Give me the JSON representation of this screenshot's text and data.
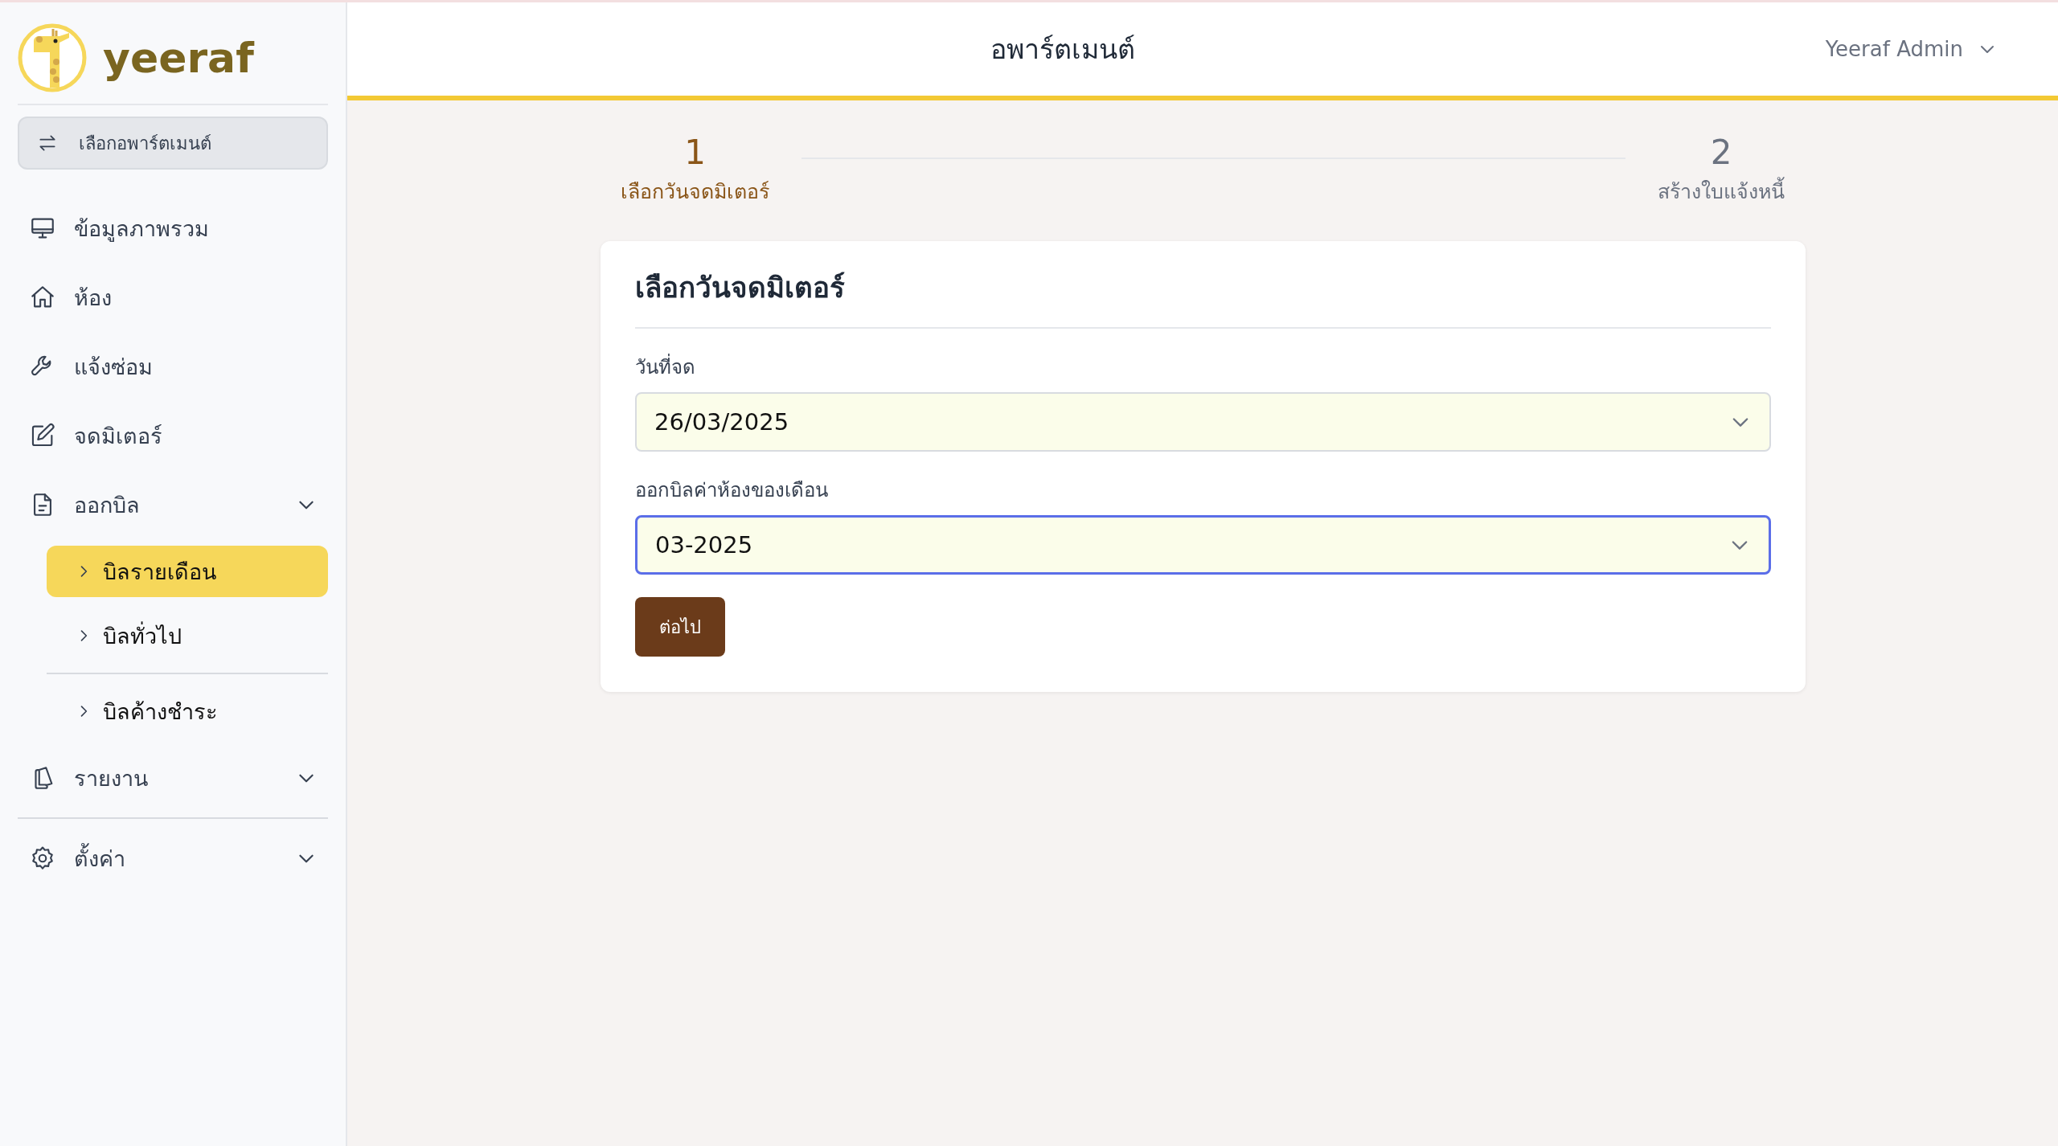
{
  "brand": {
    "name": "yeeraf"
  },
  "apartment_switch": {
    "label": "เลือกอพาร์ตเมนต์"
  },
  "sidebar": {
    "items": [
      {
        "label": "ข้อมูลภาพรวม",
        "kind": "link"
      },
      {
        "label": "ห้อง",
        "kind": "link"
      },
      {
        "label": "แจ้งซ่อม",
        "kind": "link"
      },
      {
        "label": "จดมิเตอร์",
        "kind": "link"
      },
      {
        "label": "ออกบิล",
        "kind": "group",
        "children": [
          {
            "label": "บิลรายเดือน",
            "selected": true
          },
          {
            "label": "บิลทั่วไป",
            "selected": false
          },
          {
            "label": "บิลค้างชำระ",
            "selected": false
          }
        ]
      },
      {
        "label": "รายงาน",
        "kind": "group"
      },
      {
        "label": "ตั้งค่า",
        "kind": "group"
      }
    ]
  },
  "header": {
    "title": "อพาร์ตเมนต์",
    "user": "Yeeraf Admin"
  },
  "steps": [
    {
      "number": "1",
      "label": "เลือกวันจดมิเตอร์",
      "selected": true
    },
    {
      "number": "2",
      "label": "สร้างใบแจ้งหนี้",
      "selected": false
    }
  ],
  "card": {
    "title": "เลือกวันจดมิเตอร์",
    "fields": [
      {
        "label": "วันที่จด",
        "value": "26/03/2025",
        "focused": false
      },
      {
        "label": "ออกบิลค่าห้องของเดือน",
        "value": "03-2025",
        "focused": true
      }
    ],
    "button": "ต่อไป"
  }
}
